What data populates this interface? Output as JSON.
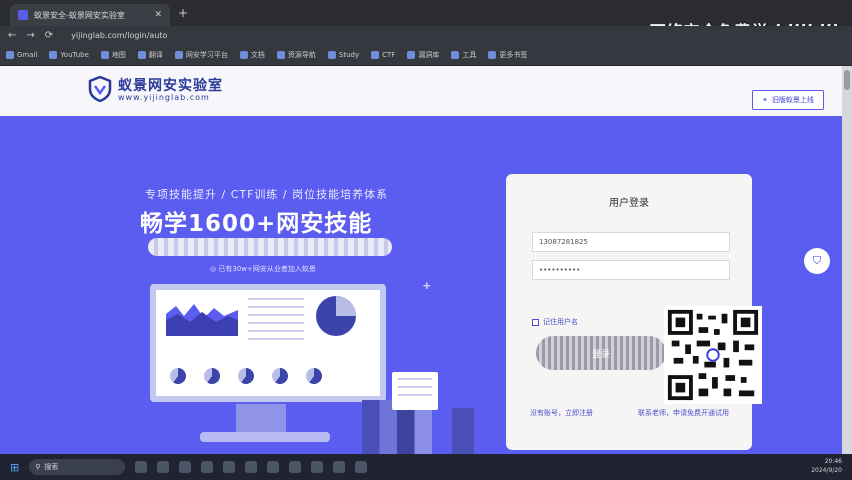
{
  "browser": {
    "tab_title": "蚁景安全-蚁景网安实验室",
    "url": "yijinglab.com/login/auto",
    "bookmarks": [
      "Gmail",
      "YouTube",
      "地图",
      "翻译",
      "网安学习平台",
      "文档",
      "资源导航",
      "Study",
      "CTF",
      "漏洞库",
      "工具",
      "更多书签"
    ]
  },
  "watermark": {
    "text": "网络安全免费学",
    "brand": "bilibili"
  },
  "site": {
    "logo_name": "蚁景网安实验室",
    "logo_url": "www.yijinglab.com",
    "header_button": "旧版蚁景上线"
  },
  "hero": {
    "subtitle": "专项技能提升 / CTF训练 / 岗位技能培养体系",
    "title": "畅学1600+网安技能",
    "note": "◎ 已有30w+网安从业者加入蚁景"
  },
  "login": {
    "title": "用户登录",
    "phone_value": "13087281825",
    "password_value": "••••••••••",
    "remember_label": "记住用户名",
    "login_button": "登录",
    "register_link": "没有账号，立即注册",
    "contact_link": "联系老师，申请免费开通试用"
  },
  "taskbar": {
    "search_label": "搜索",
    "time": "20:46",
    "date": "2024/9/20"
  },
  "colors": {
    "primary": "#5b5cf0",
    "card": "#f7f4f4",
    "header": "#f6f6fb"
  },
  "icons": [
    "back-icon",
    "forward-icon",
    "refresh-icon",
    "shield-logo-icon",
    "search-icon",
    "windows-start-icon",
    "qr-code-icon"
  ]
}
